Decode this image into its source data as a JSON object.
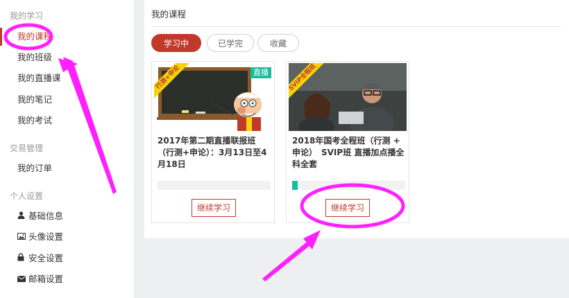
{
  "sidebar": {
    "groups": [
      {
        "title": "我的学习",
        "items": [
          {
            "label": "我的课程",
            "active": true
          },
          {
            "label": "我的班级"
          },
          {
            "label": "我的直播课"
          },
          {
            "label": "我的笔记"
          },
          {
            "label": "我的考试"
          }
        ]
      },
      {
        "title": "交易管理",
        "items": [
          {
            "label": "我的订单"
          }
        ]
      },
      {
        "title": "个人设置",
        "items": [
          {
            "label": "基础信息",
            "icon": "user-icon"
          },
          {
            "label": "头像设置",
            "icon": "image-icon"
          },
          {
            "label": "安全设置",
            "icon": "lock-icon"
          },
          {
            "label": "邮箱设置",
            "icon": "envelope-icon"
          }
        ]
      }
    ]
  },
  "main": {
    "title": "我的课程",
    "tabs": [
      {
        "label": "学习中",
        "active": true
      },
      {
        "label": "已学完"
      },
      {
        "label": "收藏"
      }
    ],
    "courses": [
      {
        "title": "2017年第二期直播联报班（行测+申论）：3月13日至4月18日",
        "ribbon": "行测+申论",
        "badge": "直播",
        "progress": 0,
        "button": "继续学习"
      },
      {
        "title": "2018年国考全程班（行测 + 申论）　SVIP班 直播加点播全科全套",
        "ribbon": "SVIP全程班",
        "progress": 0.05,
        "button": "继续学习"
      }
    ]
  },
  "colors": {
    "accent": "#c0392b",
    "progress": "#1abc9c",
    "annotation": "#ff1fff"
  }
}
